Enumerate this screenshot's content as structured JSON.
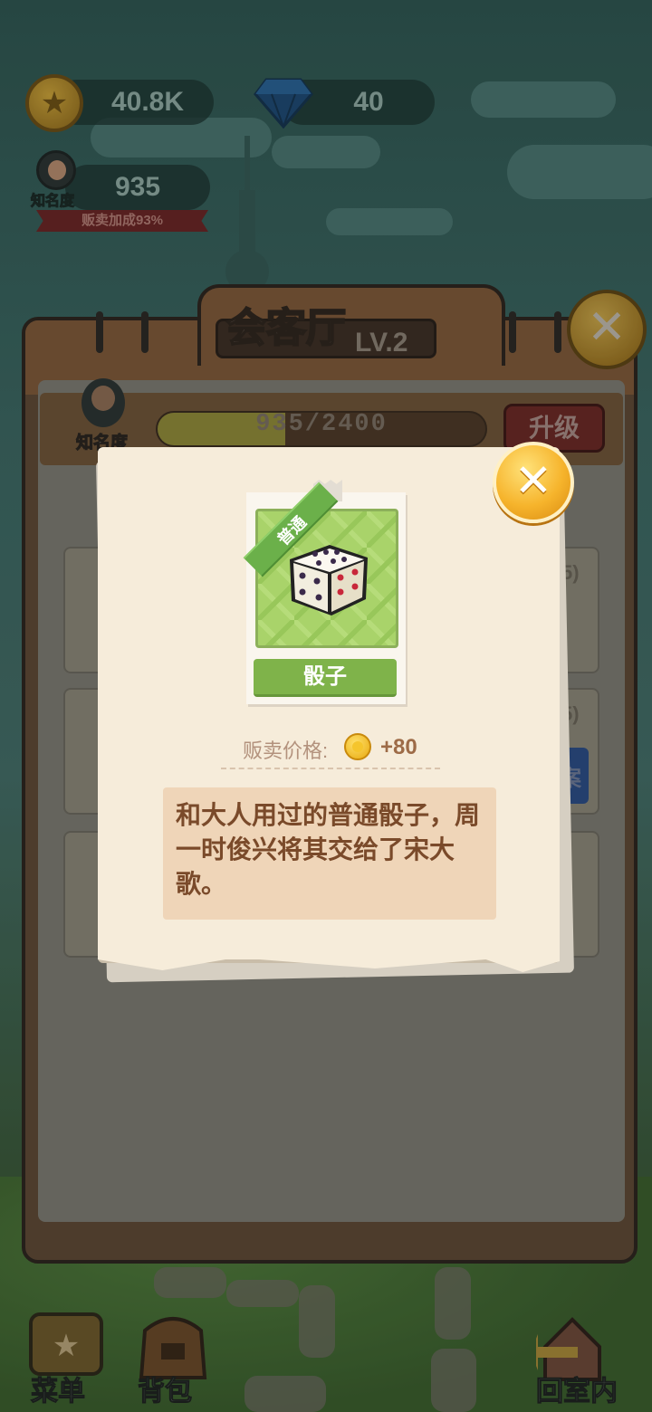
{
  "hud": {
    "coins": "40.8K",
    "gems": "40",
    "fame_value": "935",
    "fame_label": "知名度",
    "sell_bonus": "贩卖加成93%"
  },
  "panel": {
    "title": "会客厅",
    "level": "LV.2",
    "fame_label": "知名度",
    "progress_text": "935/2400",
    "progress_fraction": 0.39,
    "upgrade_label": "升级",
    "card_tags": [
      "5)",
      "5)"
    ],
    "side_button_text": "案"
  },
  "popup": {
    "rarity": "普通",
    "item_name": "骰子",
    "price_label": "贩卖价格:",
    "price_value": "+80",
    "description": "和大人用过的普通骰子，周一时俊兴将其交给了宋大歌。"
  },
  "nav": {
    "menu": "菜单",
    "bag": "背包",
    "return": "回室内"
  },
  "colors": {
    "accent": "#f6b42c",
    "item_bg": "#a9d36a",
    "rarity_ribbon": "#6bb04a",
    "desc_bg": "#efd5b8"
  },
  "icons": [
    "coin-icon",
    "gem-icon",
    "avatar-icon",
    "close-icon",
    "dice-icon",
    "menu-icon",
    "bag-icon",
    "home-return-icon"
  ]
}
